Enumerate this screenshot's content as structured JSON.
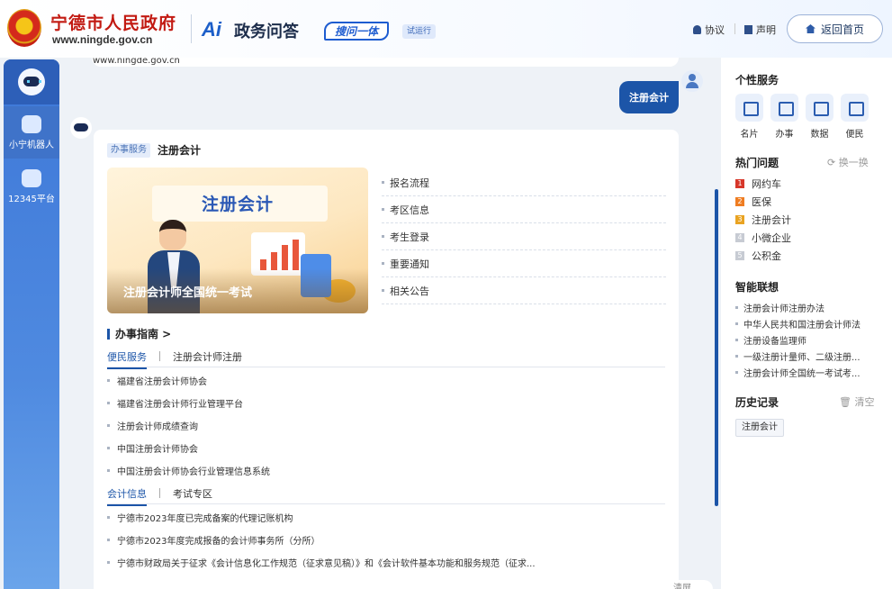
{
  "header": {
    "site_name": "宁德市人民政府",
    "site_url": "www.ningde.gov.cn",
    "ai_logo": "Ai",
    "service_title": "政务问答",
    "slogan": "搜问一体",
    "beta": "试运行",
    "agreement": "协议",
    "statement": "声明",
    "home": "返回首页"
  },
  "leftnav": {
    "items": [
      {
        "label": "小宁机器人"
      },
      {
        "label": "12345平台"
      }
    ]
  },
  "chat": {
    "prev_text": "www.ningde.gov.cn",
    "user_message": "注册会计",
    "answer": {
      "tag": "办事服务",
      "title": "注册会计",
      "banner_title": "注册会计",
      "banner_caption": "注册会计师全国统一考试",
      "links": [
        "报名流程",
        "考区信息",
        "考生登录",
        "重要通知",
        "相关公告"
      ],
      "guide_title": "办事指南 >",
      "tabs1": [
        "便民服务",
        "注册会计师注册"
      ],
      "list1": [
        "福建省注册会计师协会",
        "福建省注册会计师行业管理平台",
        "注册会计师成绩查询",
        "中国注册会计师协会",
        "中国注册会计师协会行业管理信息系统"
      ],
      "tabs2": [
        "会计信息",
        "考试专区"
      ],
      "list2": [
        "宁德市2023年度已完成备案的代理记账机构",
        "宁德市2023年度完成报备的会计师事务所（分所）",
        "宁德市财政局关于征求《会计信息化工作规范（征求意见稿）》和《会计软件基本功能和服务规范（征求..."
      ]
    },
    "bottom_pill": "清屏"
  },
  "sidebar": {
    "personal_title": "个性服务",
    "services": [
      "名片",
      "办事",
      "数据",
      "便民"
    ],
    "hot_title": "热门问题",
    "refresh": "换一换",
    "hot": [
      {
        "n": "1",
        "text": "网约车",
        "color": "#d7372a"
      },
      {
        "n": "2",
        "text": "医保",
        "color": "#ef7d22"
      },
      {
        "n": "3",
        "text": "注册会计",
        "color": "#e9a322"
      },
      {
        "n": "4",
        "text": "小微企业",
        "color": "#c7cbd3"
      },
      {
        "n": "5",
        "text": "公积金",
        "color": "#c7cbd3"
      }
    ],
    "assoc_title": "智能联想",
    "assoc": [
      "注册会计师注册办法",
      "中华人民共和国注册会计师法",
      "注册设备监理师",
      "一级注册计量师、二级注册...",
      "注册会计师全国统一考试考..."
    ],
    "history_title": "历史记录",
    "clear": "清空",
    "history": [
      "注册会计"
    ]
  }
}
